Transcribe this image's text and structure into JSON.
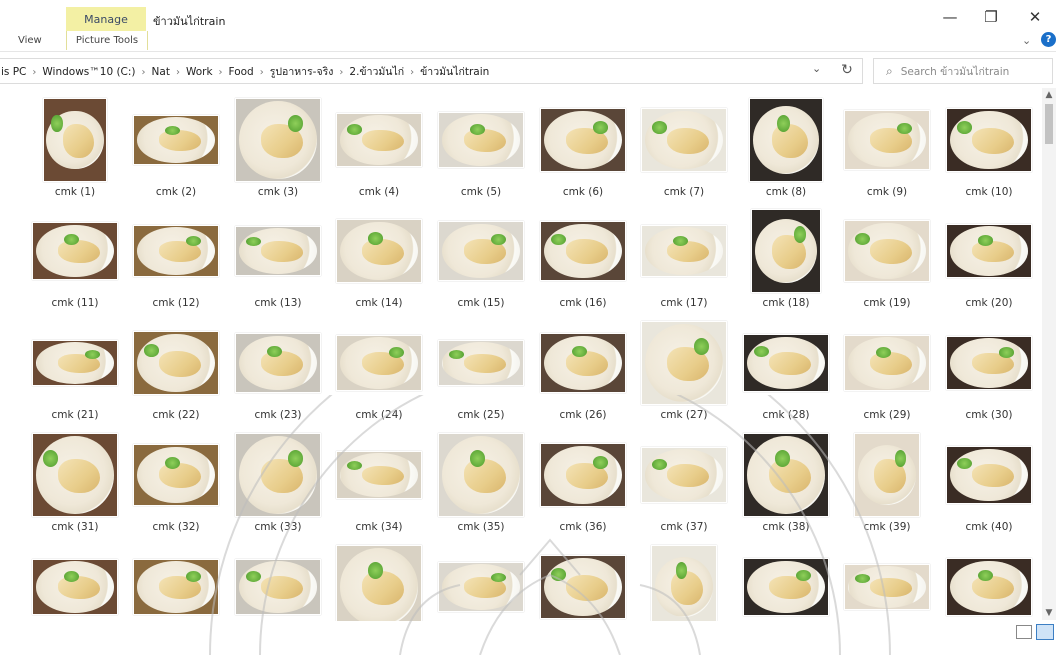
{
  "ribbon": {
    "manage_tab": "Manage",
    "window_title": "ข้าวมันไก่train",
    "view_tab": "View",
    "picture_tools_tab": "Picture Tools",
    "help_label": "?"
  },
  "window_controls": {
    "minimize": "—",
    "restore": "❐",
    "close": "✕"
  },
  "address_bar": {
    "crumbs": [
      "is PC",
      "Windows™10 (C:)",
      "Nat",
      "Work",
      "Food",
      "รูปอาหาร-จริง",
      "2.ข้าวมันไก่",
      "ข้าวมันไก่train"
    ],
    "separator": "›"
  },
  "search": {
    "placeholder": "Search ข้าวมันไก่train"
  },
  "files": [
    "cmk (1)",
    "cmk (2)",
    "cmk (3)",
    "cmk (4)",
    "cmk (5)",
    "cmk (6)",
    "cmk (7)",
    "cmk (8)",
    "cmk (9)",
    "cmk (10)",
    "cmk (11)",
    "cmk (12)",
    "cmk (13)",
    "cmk (14)",
    "cmk (15)",
    "cmk (16)",
    "cmk (17)",
    "cmk (18)",
    "cmk (19)",
    "cmk (20)",
    "cmk (21)",
    "cmk (22)",
    "cmk (23)",
    "cmk (24)",
    "cmk (25)",
    "cmk (26)",
    "cmk (27)",
    "cmk (28)",
    "cmk (29)",
    "cmk (30)",
    "cmk (31)",
    "cmk (32)",
    "cmk (33)",
    "cmk (34)",
    "cmk (35)",
    "cmk (36)",
    "cmk (37)",
    "cmk (38)",
    "cmk (39)",
    "cmk (40)",
    "",
    "",
    "",
    "",
    "",
    "",
    "",
    "",
    "",
    ""
  ],
  "colors": {
    "manage_tab_bg": "#f3f0a4",
    "help_badge": "#1a6fc9"
  }
}
